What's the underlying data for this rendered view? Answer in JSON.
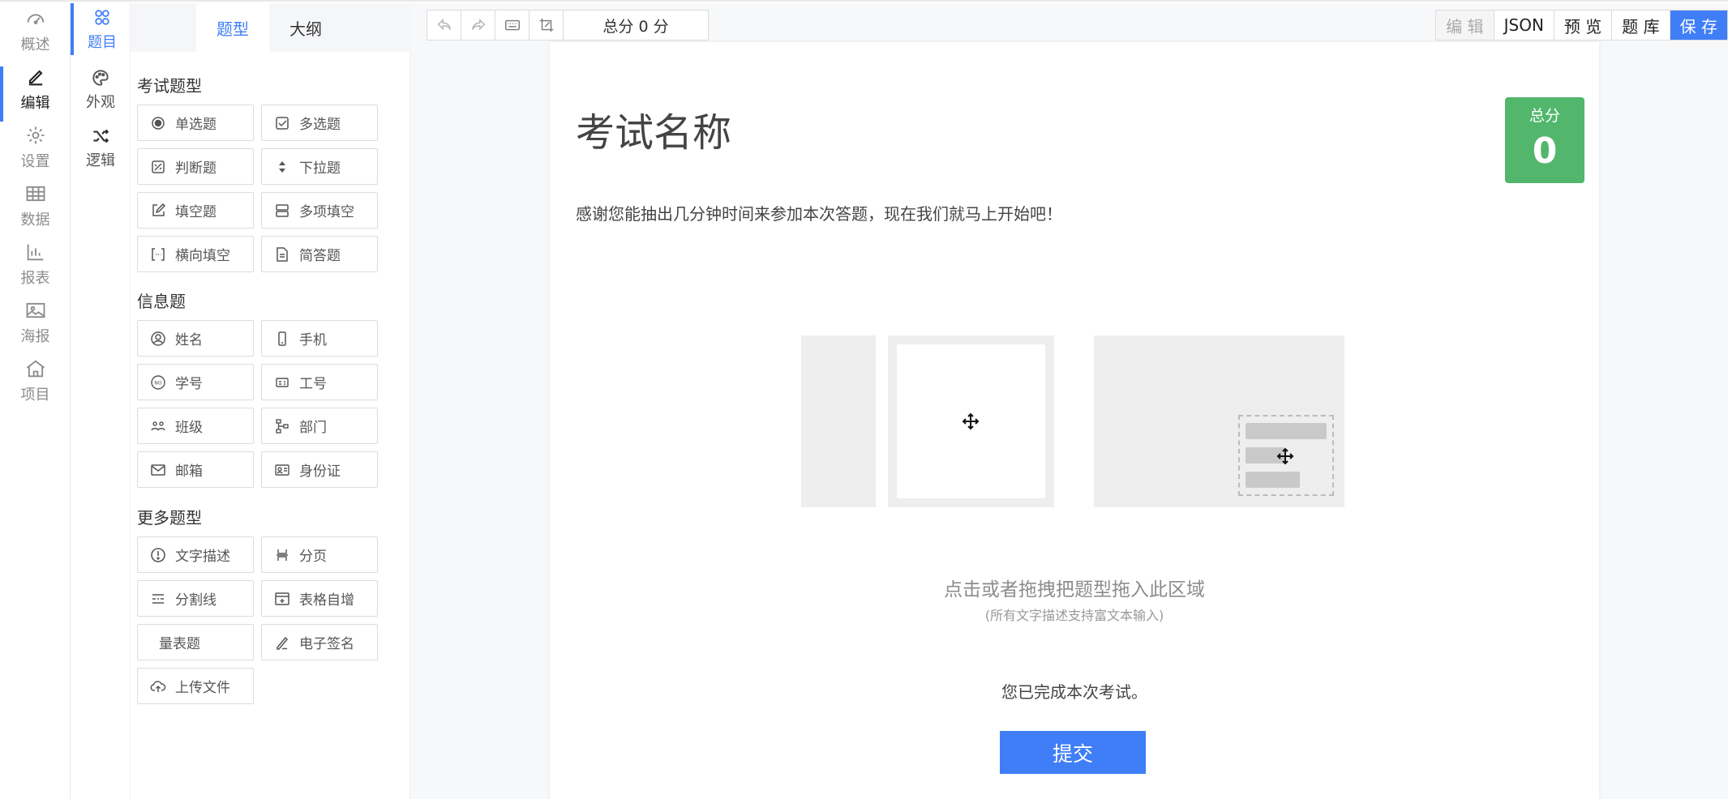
{
  "nav": {
    "items": [
      {
        "label": "概述",
        "icon": "dashboard-icon"
      },
      {
        "label": "编辑",
        "icon": "edit-pen-icon"
      },
      {
        "label": "设置",
        "icon": "gear-icon"
      },
      {
        "label": "数据",
        "icon": "table-icon"
      },
      {
        "label": "报表",
        "icon": "bar-chart-icon"
      },
      {
        "label": "海报",
        "icon": "image-icon"
      },
      {
        "label": "项目",
        "icon": "home-icon"
      }
    ]
  },
  "subnav": {
    "items": [
      {
        "label": "题目",
        "icon": "circles-icon"
      },
      {
        "label": "外观",
        "icon": "palette-icon"
      },
      {
        "label": "逻辑",
        "icon": "shuffle-icon"
      }
    ]
  },
  "palette": {
    "tabs": [
      "题型",
      "大纲"
    ],
    "groups": [
      {
        "title": "考试题型",
        "items": [
          "单选题",
          "多选题",
          "判断题",
          "下拉题",
          "填空题",
          "多项填空",
          "横向填空",
          "简答题"
        ]
      },
      {
        "title": "信息题",
        "items": [
          "姓名",
          "手机",
          "学号",
          "工号",
          "班级",
          "部门",
          "邮箱",
          "身份证"
        ]
      },
      {
        "title": "更多题型",
        "items": [
          "文字描述",
          "分页",
          "分割线",
          "表格自增",
          "量表题",
          "电子签名",
          "上传文件"
        ]
      }
    ]
  },
  "toolbar": {
    "score_text": "总分 0 分",
    "right": {
      "edit": "编 辑",
      "json": "JSON",
      "preview": "预 览",
      "bank": "题 库",
      "save": "保 存"
    }
  },
  "paper": {
    "title": "考试名称",
    "score_label": "总分",
    "score_value": "0",
    "description": "感谢您能抽出几分钟时间来参加本次答题，现在我们就马上开始吧！",
    "drop_hint": "点击或者拖拽把题型拖入此区域",
    "drop_subhint": "(所有文字描述支持富文本输入)",
    "completion": "您已完成本次考试。",
    "submit": "提交"
  },
  "colors": {
    "accent": "#3f7ef7",
    "score_card": "#52b66c"
  }
}
